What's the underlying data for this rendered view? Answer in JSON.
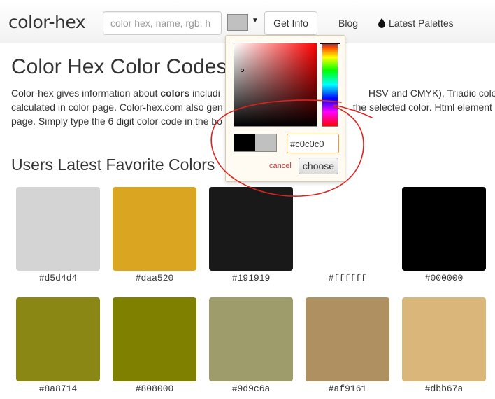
{
  "header": {
    "logo": "color-hex",
    "search_placeholder": "color hex, name, rgb, h",
    "swatch_color": "#c0c0c0",
    "get_info_label": "Get Info",
    "nav": {
      "blog": "Blog",
      "latest_palettes": "Latest Palettes"
    }
  },
  "main": {
    "title": "Color Hex Color Codes",
    "intro": {
      "line1_before": "Color-hex gives information about ",
      "line1_bold": "colors",
      "line1_after": " includi",
      "line1_right": "HSV and CMYK), Triadic colors, m",
      "line2_left": "calculated in color page. Color-hex.com also gen",
      "line2_right": "the selected color. Html element",
      "line3_left": "page. Simply type the 6 digit color code in the bo"
    },
    "favorites_title": "Users Latest Favorite Colors",
    "colors": [
      {
        "hex": "#d5d4d4"
      },
      {
        "hex": "#daa520"
      },
      {
        "hex": "#191919"
      },
      {
        "hex": "#ffffff"
      },
      {
        "hex": "#000000"
      },
      {
        "hex": "#8a8714"
      },
      {
        "hex": "#808000"
      },
      {
        "hex": "#9d9c6a"
      },
      {
        "hex": "#af9161"
      },
      {
        "hex": "#dbb67a"
      }
    ]
  },
  "picker": {
    "hex_value": "#c0c0c0",
    "old_color": "#000000",
    "new_color": "#c0c0c0",
    "cancel_label": "cancel",
    "choose_label": "choose"
  },
  "annotation_color": "#dd2222"
}
